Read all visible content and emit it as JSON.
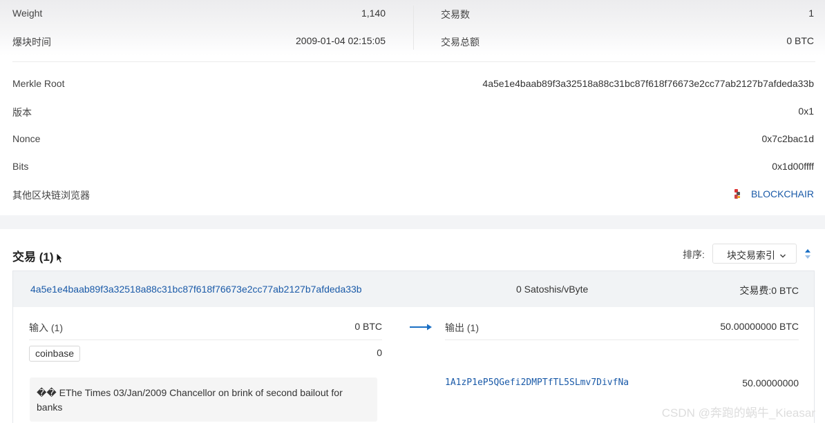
{
  "block_stats": {
    "weight_label": "Weight",
    "weight_value": "1,140",
    "time_label": "爆块时间",
    "time_value": "2009-01-04 02:15:05",
    "tx_count_label": "交易数",
    "tx_count_value": "1",
    "tx_total_label": "交易总额",
    "tx_total_value": "0 BTC"
  },
  "details": [
    {
      "label": "Merkle Root",
      "value": "4a5e1e4baab89f3a32518a88c31bc87f618f76673e2cc77ab2127b7afdeda33b"
    },
    {
      "label": "版本",
      "value": "0x1"
    },
    {
      "label": "Nonce",
      "value": "0x7c2bac1d"
    },
    {
      "label": "Bits",
      "value": "0x1d00ffff"
    }
  ],
  "explorers": {
    "label": "其他区块链浏览器",
    "link": "BLOCKCHAIR",
    "icon": "blockchair-logo-icon"
  },
  "transactions": {
    "title": "交易 (1)",
    "sort_label": "排序:",
    "sort_value": "块交易索引",
    "tx": {
      "hash": "4a5e1e4baab89f3a32518a88c31bc87f618f76673e2cc77ab2127b7afdeda33b",
      "fee_rate": "0 Satoshis/vByte",
      "fee": "交易费:0 BTC",
      "inputs_label": "输入 (1)",
      "inputs_total": "0 BTC",
      "coinbase": "coinbase",
      "coinbase_value": "0",
      "coinbase_message": "�� EThe Times 03/Jan/2009 Chancellor on brink of second bailout for banks",
      "outputs_label": "输出 (1)",
      "outputs_total": "50.00000000 BTC",
      "output_address": "1A1zP1eP5QGefi2DMPTfTL5SLmv7DivfNa",
      "output_value": "50.00000000"
    }
  },
  "watermark": "CSDN @奔跑的蜗牛_Kieasar",
  "colors": {
    "link": "#1a5aa8",
    "arrow": "#1a6fc4"
  }
}
